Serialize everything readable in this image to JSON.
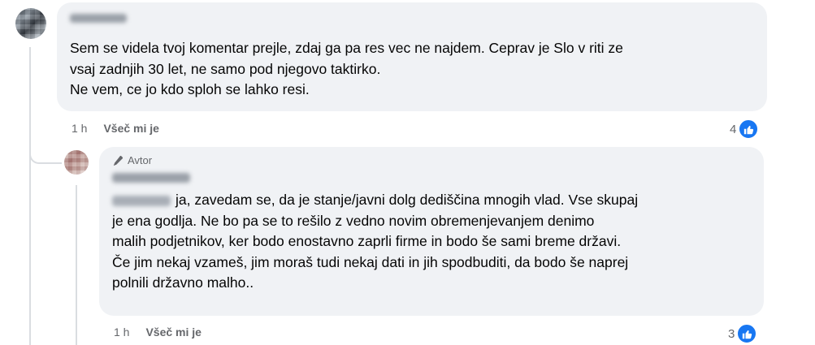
{
  "comments": [
    {
      "author_blurred": true,
      "text_lines": [
        "Sem se videla tvoj komentar prejle, zdaj ga pa res vec ne najdem. Ceprav je Slo v riti ze",
        "vsaj zadnjih 30 let, ne samo pod njegovo taktirko.",
        "Ne vem, ce jo kdo sploh se lahko resi."
      ],
      "time": "1 h",
      "like_label": "Všeč mi je",
      "reaction_count": "4",
      "reaction_icon": "like-icon"
    }
  ],
  "reply": {
    "badge_label": "Avtor",
    "badge_icon": "pen-icon",
    "author_blurred": true,
    "mention_blurred": true,
    "first_line_text": "ja, zavedam se, da je stanje/javni dolg dediščina mnogih vlad. Vse skupaj",
    "text_lines": [
      "je ena godlja. Ne bo pa se to rešilo z vedno novim obremenjevanjem denimo",
      "malih podjetnikov, ker bodo enostavno zaprli firme in bodo še sami breme državi.",
      "Če jim nekaj vzameš, jim moraš tudi nekaj dati in jih spodbuditi, da bodo še naprej",
      "polnili državno malho.."
    ],
    "time": "1 h",
    "like_label": "Všeč mi je",
    "reaction_count": "3",
    "reaction_icon": "like-icon"
  },
  "colors": {
    "bubble": "#f0f2f5",
    "secondary_text": "#65676b",
    "like_blue": "#1877f2",
    "thread_line": "#dadde1"
  }
}
